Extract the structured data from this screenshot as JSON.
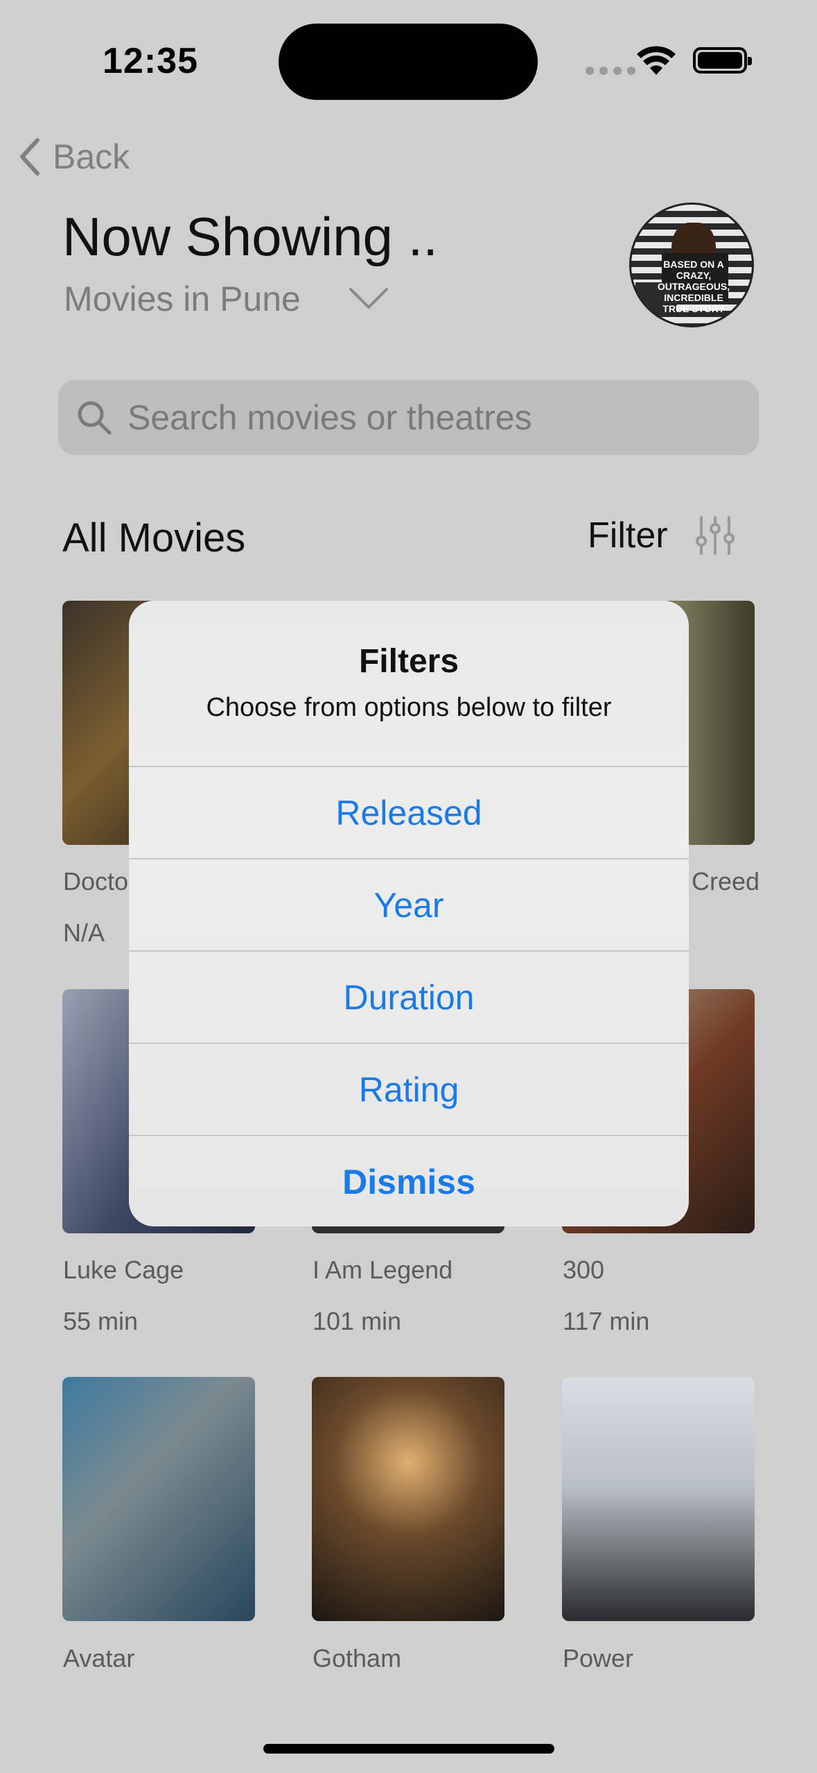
{
  "status_bar": {
    "time": "12:35"
  },
  "nav": {
    "back_label": "Back"
  },
  "header": {
    "title": "Now Showing ..",
    "location": "Movies in Pune"
  },
  "search": {
    "placeholder": "Search movies or theatres"
  },
  "section": {
    "title": "All Movies",
    "filter_label": "Filter"
  },
  "movies": [
    {
      "title": "Doctor",
      "duration": "N/A"
    },
    {
      "title": "",
      "duration": ""
    },
    {
      "title": "Creed",
      "duration": ""
    },
    {
      "title": "Luke Cage",
      "duration": "55 min"
    },
    {
      "title": "I Am Legend",
      "duration": "101 min"
    },
    {
      "title": "300",
      "duration": "117 min"
    },
    {
      "title": "Avatar",
      "duration": ""
    },
    {
      "title": "Gotham",
      "duration": ""
    },
    {
      "title": "Power",
      "duration": ""
    }
  ],
  "avatar_text": "BASED ON A CRAZY, OUTRAGEOUS, INCREDIBLE TRUE STORY",
  "alert": {
    "title": "Filters",
    "message": "Choose from options below to filter",
    "options": [
      "Released",
      "Year",
      "Duration",
      "Rating"
    ],
    "dismiss": "Dismiss"
  },
  "colors": {
    "accent": "#1a7ae6",
    "dim_background": "#cfcfcf"
  }
}
